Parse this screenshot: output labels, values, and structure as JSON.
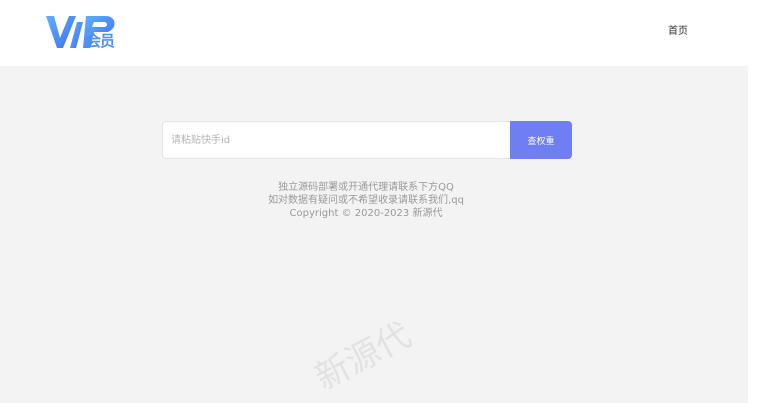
{
  "header": {
    "logo_text": "会员",
    "nav": {
      "home_label": "首页"
    }
  },
  "search": {
    "placeholder": "请粘贴快手id",
    "button_label": "查权重"
  },
  "footer": {
    "line1": "独立源码部署或开通代理请联系下方QQ",
    "line2": "如对数据有疑问或不希望收录请联系我们,qq",
    "line3": "Copyright © 2020-2023 新源代"
  },
  "watermark": "新源代",
  "colors": {
    "brand": "#4f8ff3",
    "button": "#6f7ef2",
    "background": "#f3f3f3"
  }
}
